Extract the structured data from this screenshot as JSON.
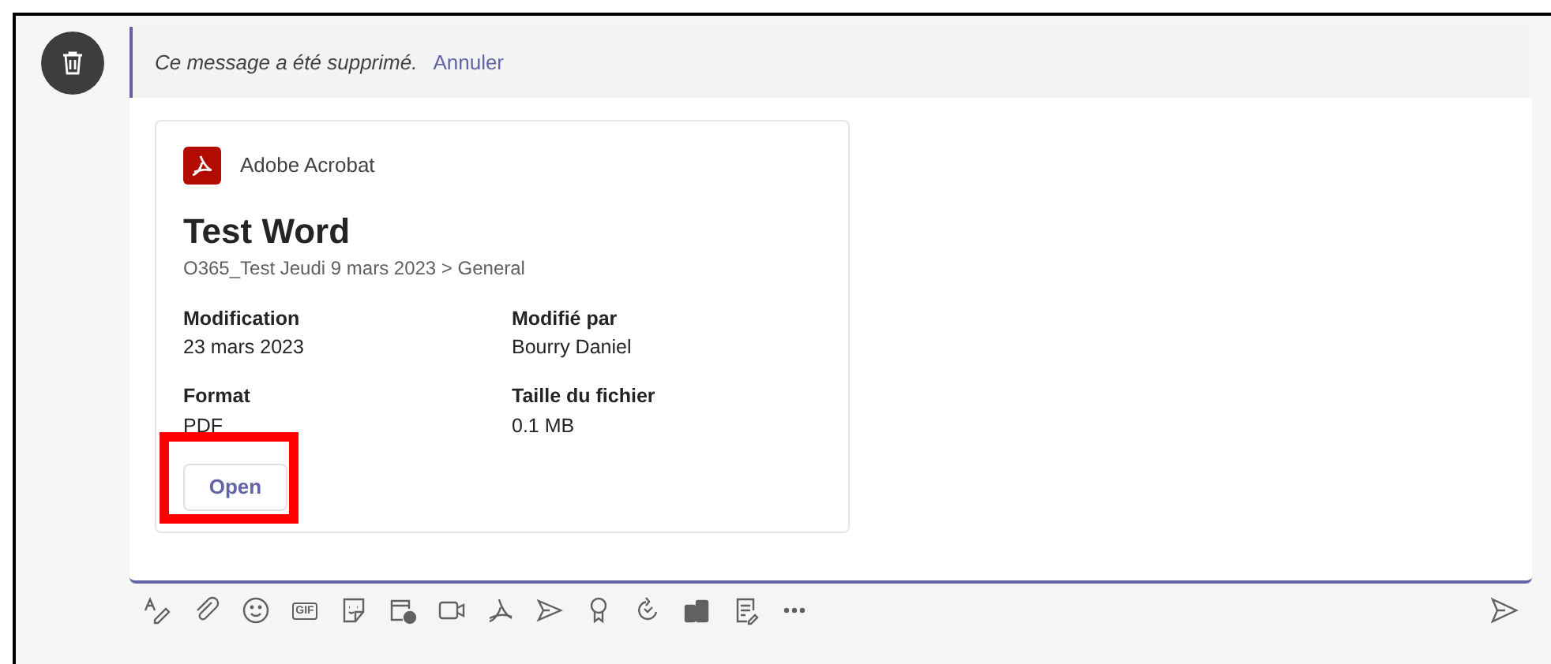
{
  "deleted_notice": {
    "text": "Ce message a été supprimé.",
    "undo_link": "Annuler"
  },
  "card": {
    "app_name": "Adobe Acrobat",
    "title": "Test Word",
    "location": "O365_Test Jeudi 9 mars 2023 > General",
    "fields": [
      {
        "label": "Modification",
        "value": "23 mars 2023"
      },
      {
        "label": "Modifié par",
        "value": "Bourry Daniel"
      },
      {
        "label": "Format",
        "value": "PDF"
      },
      {
        "label": "Taille du fichier",
        "value": "0.1 MB"
      }
    ],
    "open_button": {
      "label": "Open",
      "highlighted": true
    }
  },
  "toolbar": [
    {
      "kind": "format"
    },
    {
      "kind": "attach"
    },
    {
      "kind": "emoji"
    },
    {
      "kind": "gif",
      "label": "GIF"
    },
    {
      "kind": "sticker"
    },
    {
      "kind": "schedule"
    },
    {
      "kind": "video"
    },
    {
      "kind": "acrobat"
    },
    {
      "kind": "share"
    },
    {
      "kind": "praise"
    },
    {
      "kind": "loop"
    },
    {
      "kind": "apps"
    },
    {
      "kind": "notes"
    },
    {
      "kind": "more"
    }
  ]
}
